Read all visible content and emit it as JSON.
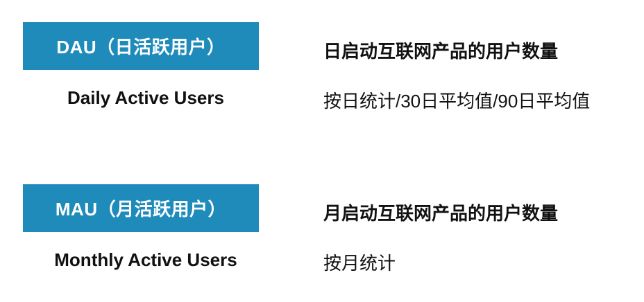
{
  "colors": {
    "term_box_bg": "#1f8bbb",
    "term_box_text": "#ffffff",
    "body_text": "#111111"
  },
  "dau": {
    "term": "DAU（日活跃用户）",
    "full_name": "Daily Active Users",
    "definition": "日启动互联网产品的用户数量",
    "method": "按日统计/30日平均值/90日平均值"
  },
  "mau": {
    "term": "MAU（月活跃用户）",
    "full_name": "Monthly Active Users",
    "definition": "月启动互联网产品的用户数量",
    "method": "按月统计"
  }
}
